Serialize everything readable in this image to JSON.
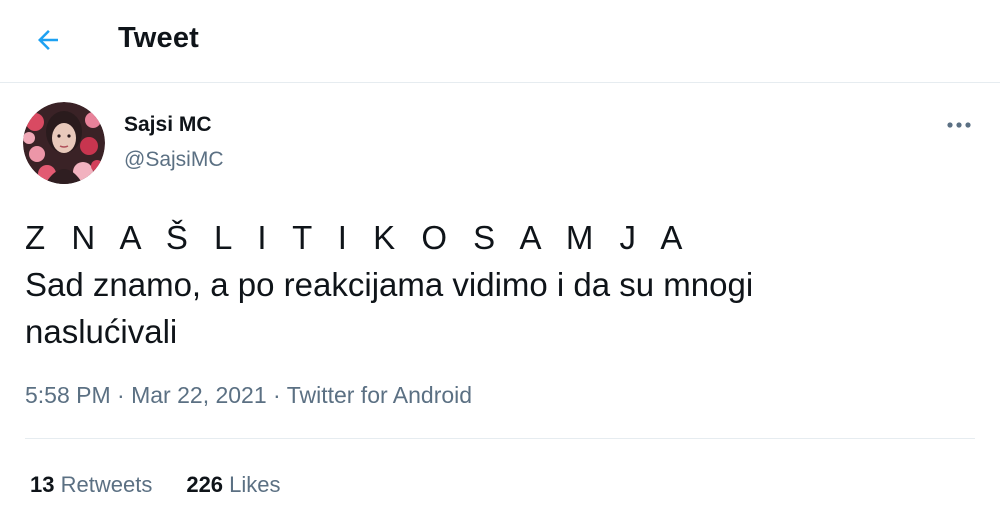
{
  "header": {
    "title": "Tweet",
    "back_icon": "arrow-left-icon",
    "accent_color": "#1da1f2"
  },
  "author": {
    "name": "Sajsi MC",
    "handle": "@SajsiMC",
    "avatar_icon": "avatar-photo"
  },
  "more_icon": "ellipsis-icon",
  "tweet": {
    "lines": [
      "Z N A Š  L I  T I  K O  S A M  J A",
      "Sad znamo, a po reakcijama vidimo i da su mnogi",
      "naslućivali"
    ]
  },
  "meta": {
    "time": "5:58 PM",
    "date": "Mar 22, 2021",
    "source": "Twitter for Android",
    "separator": "·"
  },
  "stats": {
    "retweets_count": "13",
    "retweets_label": "Retweets",
    "likes_count": "226",
    "likes_label": "Likes"
  }
}
